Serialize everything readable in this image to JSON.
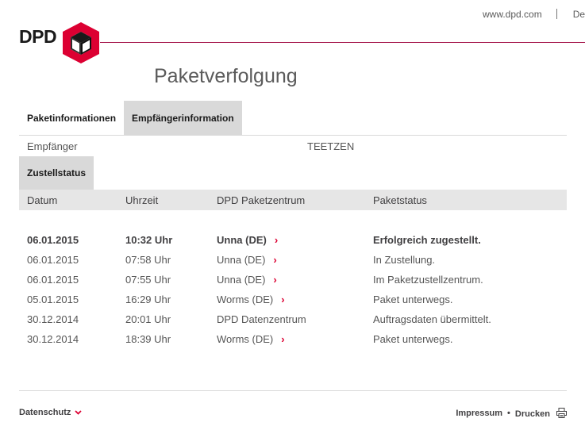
{
  "header": {
    "links": [
      "www.dpd.com",
      "De"
    ],
    "logo_text": "DPD",
    "page_title": "Paketverfolgung"
  },
  "tabs": [
    {
      "label": "Paketinformationen",
      "active": false
    },
    {
      "label": "Empfängerinformation",
      "active": true
    }
  ],
  "recipient": {
    "label": "Empfänger",
    "value": "TEETZEN"
  },
  "status_section": {
    "tab_label": "Zustellstatus",
    "columns": [
      "Datum",
      "Uhrzeit",
      "DPD Paketzentrum",
      "Paketstatus"
    ],
    "rows": [
      {
        "date": "06.01.2015",
        "time": "10:32 Uhr",
        "depot": "Unna (DE)",
        "status": "Erfolgreich zugestellt.",
        "has_link": true
      },
      {
        "date": "06.01.2015",
        "time": "07:58 Uhr",
        "depot": "Unna (DE)",
        "status": "In Zustellung.",
        "has_link": true
      },
      {
        "date": "06.01.2015",
        "time": "07:55 Uhr",
        "depot": "Unna (DE)",
        "status": "Im Paketzustellzentrum.",
        "has_link": true
      },
      {
        "date": "05.01.2015",
        "time": "16:29 Uhr",
        "depot": "Worms (DE)",
        "status": "Paket unterwegs.",
        "has_link": true
      },
      {
        "date": "30.12.2014",
        "time": "20:01 Uhr",
        "depot": "DPD Datenzentrum",
        "status": "Auftragsdaten übermittelt.",
        "has_link": false
      },
      {
        "date": "30.12.2014",
        "time": "18:39 Uhr",
        "depot": "Worms (DE)",
        "status": "Paket unterwegs.",
        "has_link": true
      }
    ]
  },
  "footer": {
    "privacy": "Datenschutz",
    "imprint": "Impressum",
    "separator": "•",
    "print": "Drucken"
  },
  "icons": {
    "logo": "dpd-cube-icon",
    "depot_link": "chevron-right-icon",
    "privacy_toggle": "chevron-down-icon",
    "print": "printer-icon"
  },
  "colors": {
    "brand_red": "#dc0032",
    "header_line": "#a4144a",
    "tab_active_bg": "#d9d9d9",
    "table_header_bg": "#e6e6e6"
  }
}
